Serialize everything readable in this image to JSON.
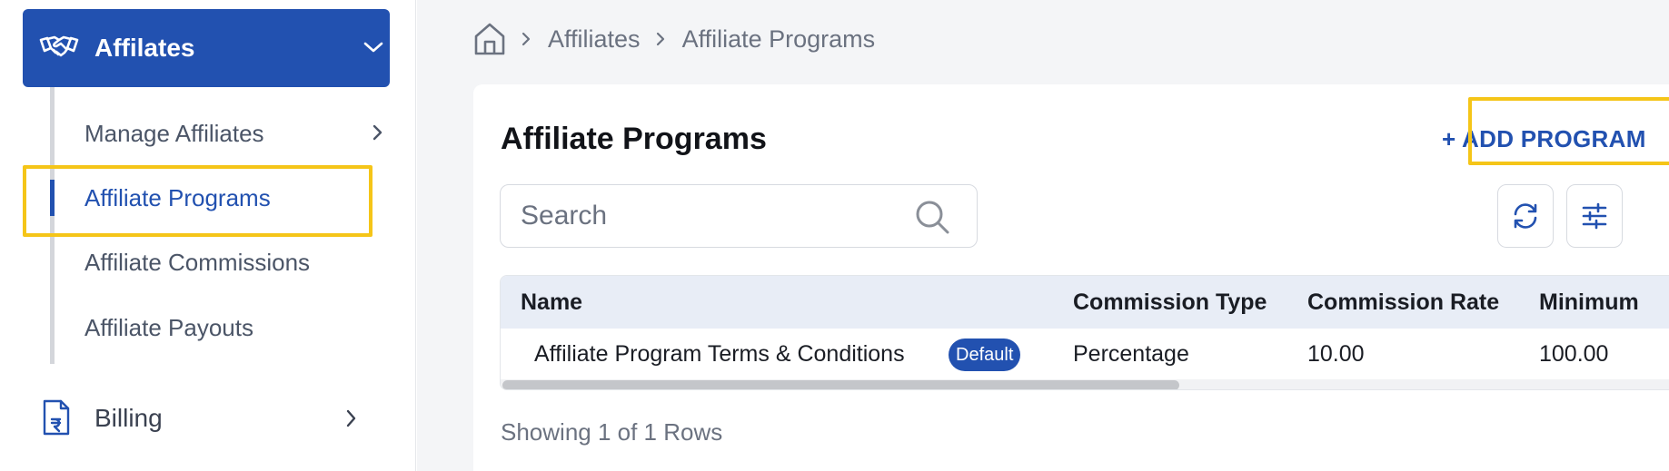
{
  "sidebar": {
    "group": {
      "label": "Affilates",
      "icon": "handshake-icon",
      "accent_color": "#2251b0"
    },
    "items": [
      {
        "label": "Manage Affiliates",
        "has_submenu": true
      },
      {
        "label": "Affiliate Programs",
        "active": true
      },
      {
        "label": "Affiliate Commissions"
      },
      {
        "label": "Affiliate Payouts"
      }
    ],
    "billing": {
      "label": "Billing",
      "icon": "invoice-icon"
    }
  },
  "breadcrumb": {
    "home_icon": "home-icon",
    "items": [
      "Affiliates",
      "Affiliate Programs"
    ]
  },
  "page": {
    "title": "Affiliate Programs",
    "add_button": "+ ADD PROGRAM",
    "search_placeholder": "Search",
    "refresh_icon": "refresh-icon",
    "filter_icon": "filter-sliders-icon"
  },
  "table": {
    "columns": [
      "Name",
      "Commission Type",
      "Commission Rate",
      "Minimum"
    ],
    "rows": [
      {
        "name": "Affiliate Program Terms & Conditions",
        "badge": "Default",
        "commission_type": "Percentage",
        "commission_rate": "10.00",
        "minimum": "100.00"
      }
    ]
  },
  "footer": {
    "row_count": "Showing 1 of 1 Rows"
  },
  "highlight_color": "#f5c518"
}
